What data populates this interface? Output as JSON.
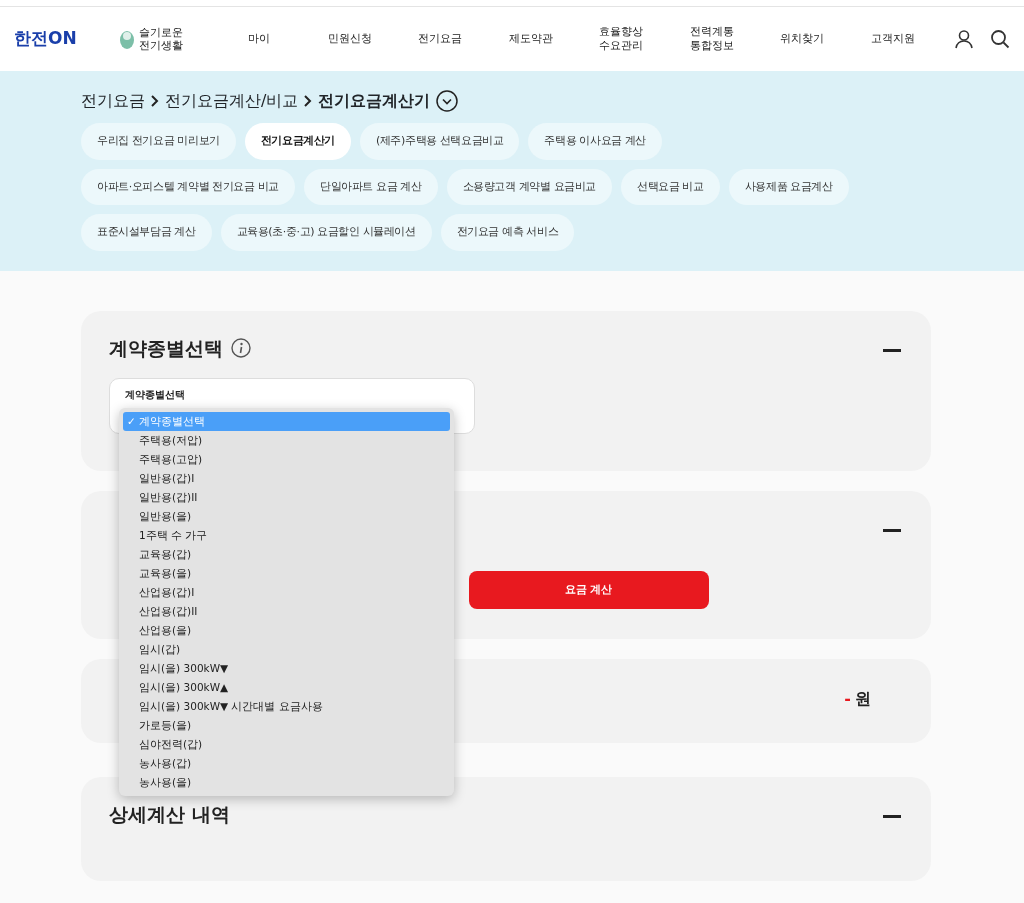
{
  "header": {
    "logo": "한전ON",
    "promo": "슬기로운\n전기생활",
    "menu": [
      "마이",
      "민원신청",
      "전기요금",
      "제도약관",
      "효율향상\n수요관리",
      "전력계통\n통합정보",
      "위치찾기",
      "고객지원"
    ]
  },
  "breadcrumb": [
    "전기요금",
    "전기요금계산/비교",
    "전기요금계산기"
  ],
  "pills": [
    {
      "label": "우리집 전기요금 미리보기",
      "selected": false
    },
    {
      "label": "전기요금계산기",
      "selected": true
    },
    {
      "label": "(제주)주택용 선택요금비교",
      "selected": false
    },
    {
      "label": "주택용 이사요금 계산",
      "selected": false
    },
    {
      "label": "아파트·오피스텔 계약별 전기요금 비교",
      "selected": false
    },
    {
      "label": "단일아파트 요금 계산",
      "selected": false
    },
    {
      "label": "소용량고객 계약별 요금비교",
      "selected": false
    },
    {
      "label": "선택요금 비교",
      "selected": false
    },
    {
      "label": "사용제품 요금계산",
      "selected": false
    },
    {
      "label": "표준시설부담금 계산",
      "selected": false
    },
    {
      "label": "교육용(초·중·고) 요금할인 시뮬레이션",
      "selected": false
    },
    {
      "label": "전기요금 예측 서비스",
      "selected": false
    }
  ],
  "contract_section": {
    "title": "계약종별선택",
    "field_label": "계약종별선택",
    "check_glyph": "✓",
    "options": [
      {
        "label": "계약종별선택",
        "selected": true
      },
      {
        "label": "주택용(저압)",
        "selected": false
      },
      {
        "label": "주택용(고압)",
        "selected": false
      },
      {
        "label": "일반용(갑)I",
        "selected": false
      },
      {
        "label": "일반용(갑)II",
        "selected": false
      },
      {
        "label": "일반용(을)",
        "selected": false
      },
      {
        "label": "1주택 수 가구",
        "selected": false
      },
      {
        "label": "교육용(갑)",
        "selected": false
      },
      {
        "label": "교육용(을)",
        "selected": false
      },
      {
        "label": "산업용(갑)I",
        "selected": false
      },
      {
        "label": "산업용(갑)II",
        "selected": false
      },
      {
        "label": "산업용(을)",
        "selected": false
      },
      {
        "label": "임시(갑)",
        "selected": false
      },
      {
        "label": "임시(을) 300kW▼",
        "selected": false
      },
      {
        "label": "임시(을) 300kW▲",
        "selected": false
      },
      {
        "label": "임시(을) 300kW▼ 시간대별 요금사용",
        "selected": false
      },
      {
        "label": "가로등(을)",
        "selected": false
      },
      {
        "label": "심야전력(갑)",
        "selected": false
      },
      {
        "label": "농사용(갑)",
        "selected": false
      },
      {
        "label": "농사용(을)",
        "selected": false
      }
    ]
  },
  "calc_section": {
    "button": "요금 계산"
  },
  "result_section": {
    "amount": "-",
    "unit": "원"
  },
  "detail_section": {
    "title": "상세계산 내역"
  }
}
